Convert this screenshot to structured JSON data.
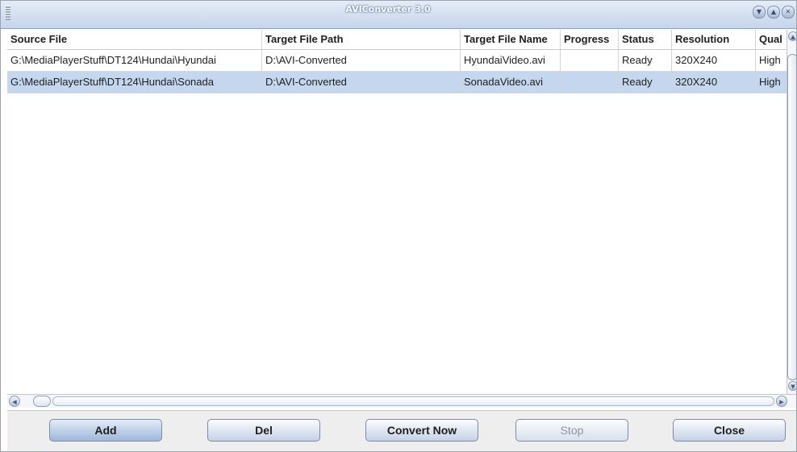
{
  "window": {
    "title": "AVIConverter 3.0"
  },
  "window_buttons": {
    "minimize": "▼",
    "maximize": "▲",
    "close": "✕"
  },
  "table": {
    "columns": [
      "Source File",
      "Target File Path",
      "Target File Name",
      "Progress",
      "Status",
      "Resolution",
      "Qual"
    ],
    "rows": [
      {
        "source": "G:\\MediaPlayerStuff\\DT124\\Hundai\\Hyundai",
        "target_path": "D:\\AVI-Converted",
        "target_name": "HyundaiVideo.avi",
        "progress": "",
        "status": "Ready",
        "resolution": "320X240",
        "quality": "High",
        "selected": false
      },
      {
        "source": "G:\\MediaPlayerStuff\\DT124\\Hundai\\Sonada",
        "target_path": "D:\\AVI-Converted",
        "target_name": "SonadaVideo.avi",
        "progress": "",
        "status": "Ready",
        "resolution": "320X240",
        "quality": "High",
        "selected": true
      }
    ]
  },
  "buttons": {
    "add": "Add",
    "del": "Del",
    "convert": "Convert Now",
    "stop": "Stop",
    "close": "Close"
  },
  "colors": {
    "selected_row": "#c5d7ee",
    "titlebar": "#c6d5ea",
    "button_face": "#c5d2e6"
  }
}
